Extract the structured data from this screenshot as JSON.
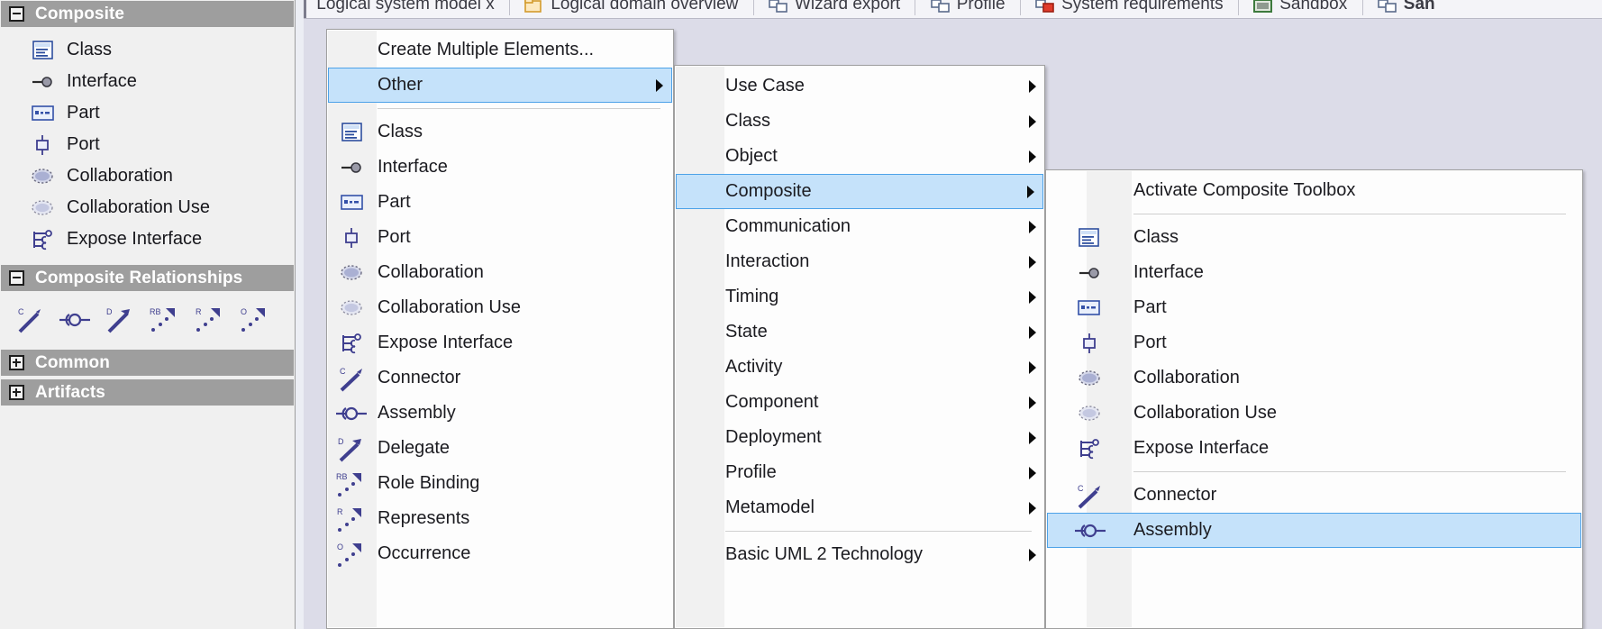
{
  "toolbox": {
    "sections": [
      {
        "title": "Composite",
        "state": "expanded"
      },
      {
        "title": "Composite Relationships",
        "state": "expanded"
      },
      {
        "title": "Common",
        "state": "collapsed"
      },
      {
        "title": "Artifacts",
        "state": "collapsed"
      }
    ],
    "composite_items": [
      {
        "label": "Class",
        "icon": "class-icon"
      },
      {
        "label": "Interface",
        "icon": "interface-icon"
      },
      {
        "label": "Part",
        "icon": "part-icon"
      },
      {
        "label": "Port",
        "icon": "port-icon"
      },
      {
        "label": "Collaboration",
        "icon": "collaboration-icon"
      },
      {
        "label": "Collaboration Use",
        "icon": "collaboration-use-icon"
      },
      {
        "label": "Expose Interface",
        "icon": "expose-interface-icon"
      }
    ],
    "relationship_items": [
      {
        "label": "Connector",
        "icon": "connector-icon"
      },
      {
        "label": "Assembly",
        "icon": "assembly-icon"
      },
      {
        "label": "Delegate",
        "icon": "delegate-icon"
      },
      {
        "label": "Role Binding",
        "icon": "role-binding-icon"
      },
      {
        "label": "Represents",
        "icon": "represents-icon"
      },
      {
        "label": "Occurrence",
        "icon": "occurrence-icon"
      }
    ]
  },
  "tabs": [
    {
      "label": "Logical system model x",
      "icon": "none",
      "active": false
    },
    {
      "label": "Logical domain overview",
      "icon": "package-yellow-icon",
      "active": false
    },
    {
      "label": "Wizard export",
      "icon": "diagram-icon",
      "active": false
    },
    {
      "label": "Profile",
      "icon": "diagram-icon",
      "active": false
    },
    {
      "label": "System requirements",
      "icon": "requirement-red-icon",
      "active": false
    },
    {
      "label": "Sandbox",
      "icon": "diagram-green-icon",
      "active": false
    },
    {
      "label": "San",
      "icon": "diagram-icon",
      "active": true
    }
  ],
  "menu1": {
    "name": "new-element-menu",
    "items": [
      {
        "label": "Create Multiple Elements...",
        "icon": "none",
        "submenu": false,
        "selected": false
      },
      {
        "label": "Other",
        "icon": "none",
        "submenu": true,
        "selected": true
      },
      {
        "separator": true
      },
      {
        "label": "Class",
        "icon": "class-icon",
        "submenu": false,
        "selected": false
      },
      {
        "label": "Interface",
        "icon": "interface-icon",
        "submenu": false,
        "selected": false
      },
      {
        "label": "Part",
        "icon": "part-icon",
        "submenu": false,
        "selected": false
      },
      {
        "label": "Port",
        "icon": "port-icon",
        "submenu": false,
        "selected": false
      },
      {
        "label": "Collaboration",
        "icon": "collaboration-icon",
        "submenu": false,
        "selected": false
      },
      {
        "label": "Collaboration Use",
        "icon": "collaboration-use-icon",
        "submenu": false,
        "selected": false
      },
      {
        "label": "Expose Interface",
        "icon": "expose-interface-icon",
        "submenu": false,
        "selected": false
      },
      {
        "label": "Connector",
        "icon": "connector-icon",
        "submenu": false,
        "selected": false
      },
      {
        "label": "Assembly",
        "icon": "assembly-icon",
        "submenu": false,
        "selected": false
      },
      {
        "label": "Delegate",
        "icon": "delegate-icon",
        "submenu": false,
        "selected": false
      },
      {
        "label": "Role Binding",
        "icon": "role-binding-icon",
        "submenu": false,
        "selected": false
      },
      {
        "label": "Represents",
        "icon": "represents-icon",
        "submenu": false,
        "selected": false
      },
      {
        "label": "Occurrence",
        "icon": "occurrence-icon",
        "submenu": false,
        "selected": false
      }
    ]
  },
  "menu2": {
    "name": "other-submenu",
    "items": [
      {
        "label": "Use Case",
        "submenu": true,
        "selected": false
      },
      {
        "label": "Class",
        "submenu": true,
        "selected": false
      },
      {
        "label": "Object",
        "submenu": true,
        "selected": false
      },
      {
        "label": "Composite",
        "submenu": true,
        "selected": true
      },
      {
        "label": "Communication",
        "submenu": true,
        "selected": false
      },
      {
        "label": "Interaction",
        "submenu": true,
        "selected": false
      },
      {
        "label": "Timing",
        "submenu": true,
        "selected": false
      },
      {
        "label": "State",
        "submenu": true,
        "selected": false
      },
      {
        "label": "Activity",
        "submenu": true,
        "selected": false
      },
      {
        "label": "Component",
        "submenu": true,
        "selected": false
      },
      {
        "label": "Deployment",
        "submenu": true,
        "selected": false
      },
      {
        "label": "Profile",
        "submenu": true,
        "selected": false
      },
      {
        "label": "Metamodel",
        "submenu": true,
        "selected": false
      },
      {
        "separator": true
      },
      {
        "label": "Basic UML 2 Technology",
        "submenu": true,
        "selected": false
      }
    ]
  },
  "menu3": {
    "name": "composite-submenu",
    "items": [
      {
        "label": "Activate Composite Toolbox",
        "icon": "none",
        "selected": false
      },
      {
        "separator": true
      },
      {
        "label": "Class",
        "icon": "class-icon",
        "selected": false
      },
      {
        "label": "Interface",
        "icon": "interface-icon",
        "selected": false
      },
      {
        "label": "Part",
        "icon": "part-icon",
        "selected": false
      },
      {
        "label": "Port",
        "icon": "port-icon",
        "selected": false
      },
      {
        "label": "Collaboration",
        "icon": "collaboration-icon",
        "selected": false
      },
      {
        "label": "Collaboration Use",
        "icon": "collaboration-use-icon",
        "selected": false
      },
      {
        "label": "Expose Interface",
        "icon": "expose-interface-icon",
        "selected": false
      },
      {
        "separator": true
      },
      {
        "label": "Connector",
        "icon": "connector-icon",
        "selected": false
      },
      {
        "label": "Assembly",
        "icon": "assembly-icon",
        "selected": true
      }
    ]
  },
  "colors": {
    "selection_fill": "#c5e2fa",
    "selection_border": "#4da2e8",
    "section_header": "#9e9e9e",
    "panel_bg": "#f0f0f0",
    "menu_bg": "#fdfdfd",
    "menu_gutter": "#f1f1f1",
    "diagram_bg": "#dcdce8",
    "icon_purple": "#3f3f8f"
  }
}
